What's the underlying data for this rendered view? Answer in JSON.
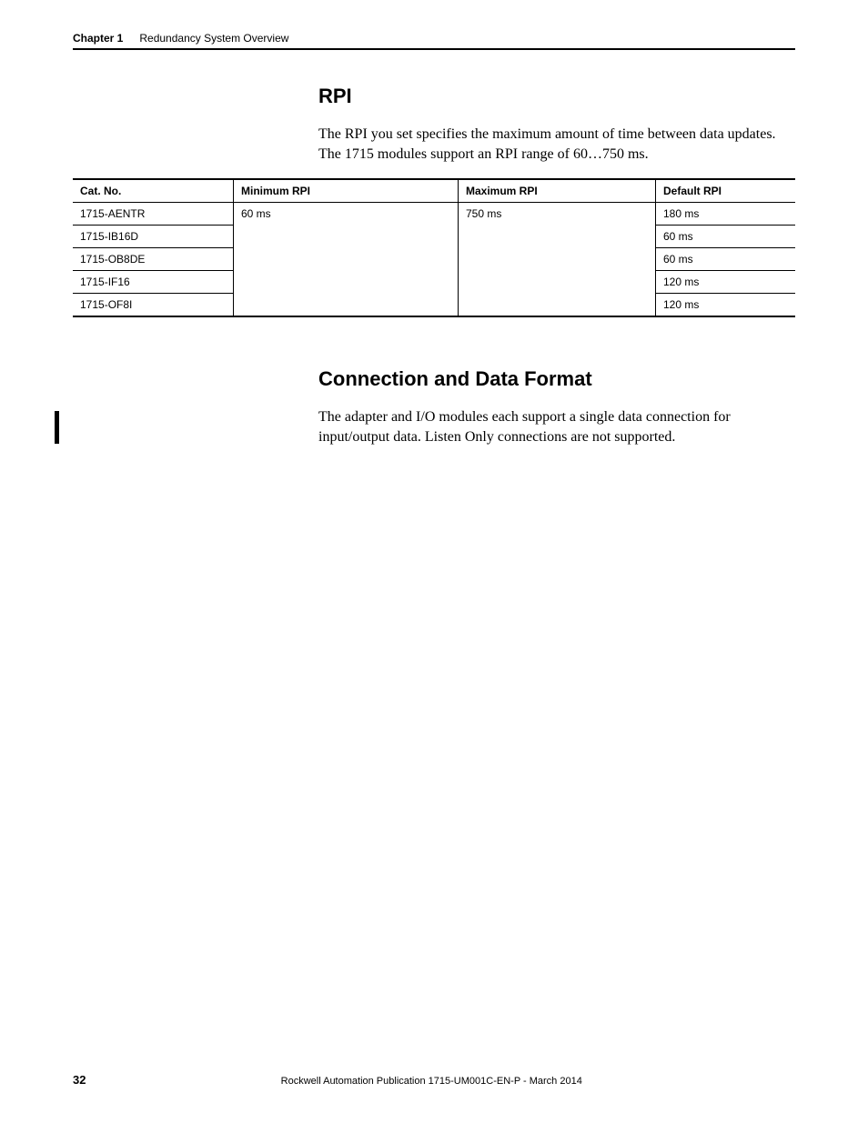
{
  "header": {
    "chapter_label": "Chapter 1",
    "chapter_title": "Redundancy System Overview"
  },
  "section_rpi": {
    "heading": "RPI",
    "body": "The RPI you set specifies the maximum amount of time between data updates. The 1715 modules support an RPI range of 60…750 ms."
  },
  "table": {
    "headers": {
      "catno": "Cat. No.",
      "min": "Minimum RPI",
      "max": "Maximum RPI",
      "def": "Default RPI"
    },
    "shared": {
      "min": "60 ms",
      "max": "750 ms"
    },
    "rows": [
      {
        "catno": "1715-AENTR",
        "def": "180 ms"
      },
      {
        "catno": "1715-IB16D",
        "def": "60 ms"
      },
      {
        "catno": "1715-OB8DE",
        "def": "60 ms"
      },
      {
        "catno": "1715-IF16",
        "def": "120 ms"
      },
      {
        "catno": "1715-OF8I",
        "def": "120 ms"
      }
    ]
  },
  "section_conn": {
    "heading": "Connection and Data Format",
    "body": "The adapter and I/O modules each support a single data connection for input/output data. Listen Only connections are not supported."
  },
  "footer": {
    "page": "32",
    "pub": "Rockwell Automation Publication 1715-UM001C-EN-P - March 2014"
  }
}
